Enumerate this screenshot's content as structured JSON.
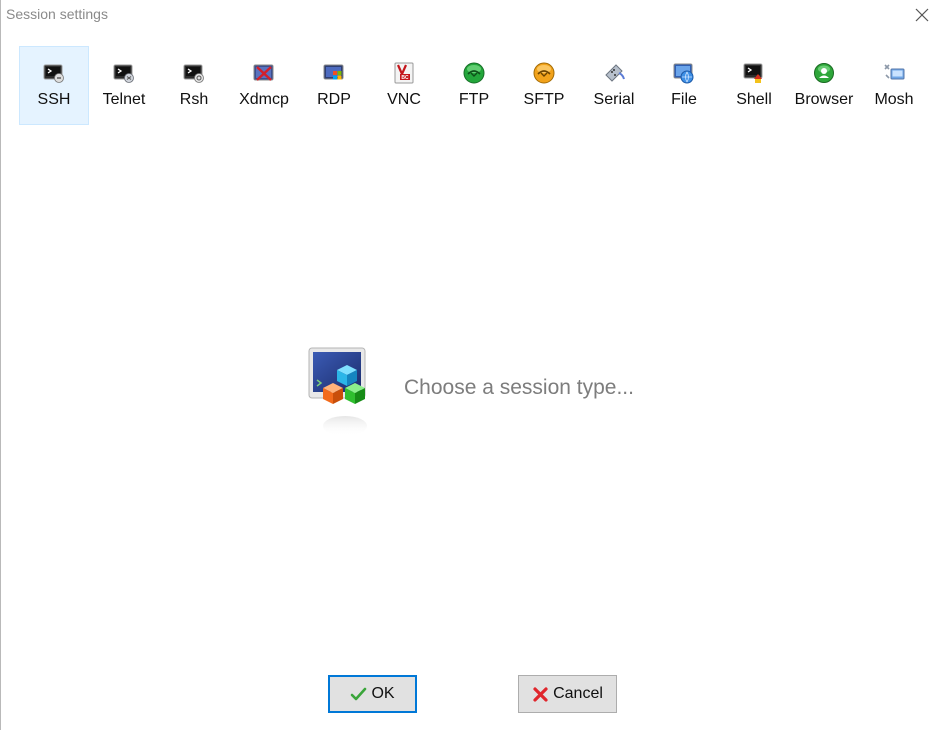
{
  "window": {
    "title": "Session settings"
  },
  "toolbar": {
    "selected": "SSH",
    "items": [
      {
        "label": "SSH",
        "icon": "ssh-icon"
      },
      {
        "label": "Telnet",
        "icon": "telnet-icon"
      },
      {
        "label": "Rsh",
        "icon": "rsh-icon"
      },
      {
        "label": "Xdmcp",
        "icon": "xdmcp-icon"
      },
      {
        "label": "RDP",
        "icon": "rdp-icon"
      },
      {
        "label": "VNC",
        "icon": "vnc-icon"
      },
      {
        "label": "FTP",
        "icon": "ftp-icon"
      },
      {
        "label": "SFTP",
        "icon": "sftp-icon"
      },
      {
        "label": "Serial",
        "icon": "serial-icon"
      },
      {
        "label": "File",
        "icon": "file-icon"
      },
      {
        "label": "Shell",
        "icon": "shell-icon"
      },
      {
        "label": "Browser",
        "icon": "browser-icon"
      },
      {
        "label": "Mosh",
        "icon": "mosh-icon"
      }
    ]
  },
  "main": {
    "prompt": "Choose a session type..."
  },
  "buttons": {
    "ok_label": "OK",
    "cancel_label": "Cancel"
  },
  "colors": {
    "selected_bg": "#e5f3ff",
    "ok_border": "#0078d7",
    "prompt_text": "#7d7d7d"
  }
}
